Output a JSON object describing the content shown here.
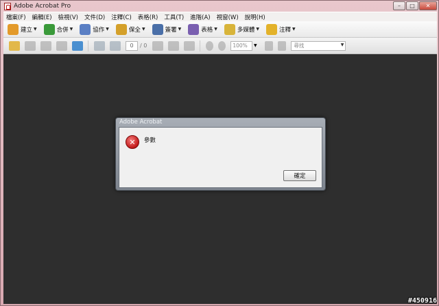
{
  "window": {
    "title": "Adobe Acrobat Pro",
    "controls": {
      "minimize": "–",
      "maximize": "□",
      "close": "✕"
    }
  },
  "menubar": {
    "items": [
      "檔案(F)",
      "編輯(E)",
      "檢視(V)",
      "文件(D)",
      "注釋(C)",
      "表格(R)",
      "工具(T)",
      "進階(A)",
      "視窗(W)",
      "說明(H)"
    ]
  },
  "toolbar": {
    "items": [
      {
        "label": "建立",
        "icon": "create-icon",
        "color": "#e39a2a"
      },
      {
        "label": "合併",
        "icon": "combine-icon",
        "color": "#3a9a3a"
      },
      {
        "label": "協作",
        "icon": "collaborate-icon",
        "color": "#5a7fc4"
      },
      {
        "label": "保全",
        "icon": "lock-icon",
        "color": "#d4a02a"
      },
      {
        "label": "簽署",
        "icon": "pen-icon",
        "color": "#4a6fa8"
      },
      {
        "label": "表格",
        "icon": "form-icon",
        "color": "#7a5fb0"
      },
      {
        "label": "多媒體",
        "icon": "multimedia-icon",
        "color": "#d8b43a"
      },
      {
        "label": "注釋",
        "icon": "comment-icon",
        "color": "#e3b22a"
      }
    ]
  },
  "toolbar2": {
    "page_number": "0",
    "page_total": "/ 0",
    "zoom": "100%",
    "search_placeholder": "尋找"
  },
  "dialog": {
    "title": "Adobe Acrobat",
    "message": "參數",
    "ok_label": "確定",
    "icon": "error-icon"
  },
  "watermark": "#450916"
}
